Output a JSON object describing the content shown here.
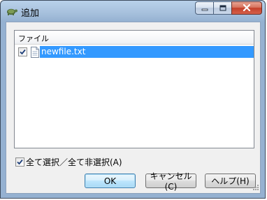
{
  "window": {
    "title": "追加",
    "icons": {
      "app": "turtle-app-icon",
      "minimize": "minimize-icon",
      "maximize": "maximize-icon",
      "close": "close-icon"
    }
  },
  "file_list": {
    "column_header": "ファイル",
    "rows": [
      {
        "name": "newfile.txt",
        "checked": true,
        "selected": true,
        "icon": "text-file-icon"
      }
    ]
  },
  "select_all": {
    "label": "全て選択／全て非選択(A)",
    "checked": true
  },
  "buttons": {
    "ok": "OK",
    "cancel": "キャンセル(C)",
    "help": "ヘルプ(H)"
  },
  "colors": {
    "selection": "#3399ff",
    "titlebar": "#b9d1ea",
    "dialog_bg": "#f0f0f0",
    "close_button": "#c4402a"
  }
}
